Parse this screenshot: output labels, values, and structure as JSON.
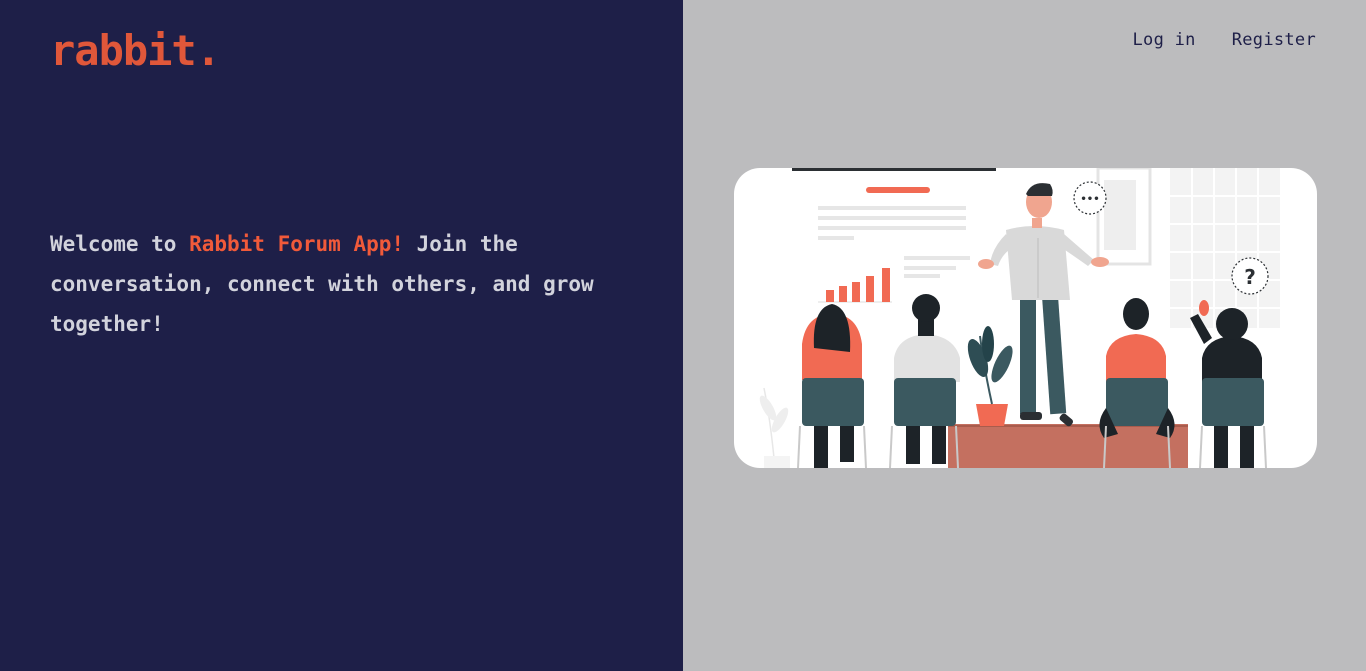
{
  "brand": {
    "name": "rabbit."
  },
  "nav": {
    "login": "Log in",
    "register": "Register"
  },
  "hero": {
    "welcome_prefix": "Welcome to ",
    "app_name": "Rabbit Forum App!",
    "welcome_suffix": " Join the conversation, connect with others, and grow together!"
  },
  "illustration": {
    "question_mark": "?",
    "speech_dots": "•••"
  },
  "colors": {
    "left_bg": "#1e1f48",
    "right_bg": "#bcbcbe",
    "accent": "#f15a3a",
    "chair": "#3b5960"
  }
}
